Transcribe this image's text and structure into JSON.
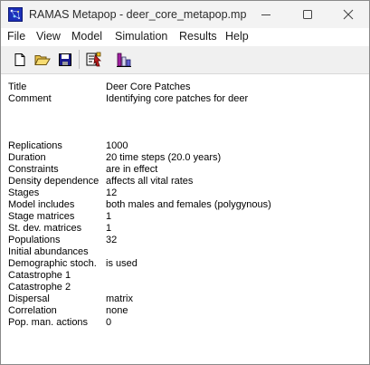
{
  "window": {
    "title": "RAMAS Metapop - deer_core_metapop.mp",
    "app_icon": "ramas-metapop-app-icon",
    "controls": {
      "minimize": "minimize-icon",
      "maximize": "maximize-icon",
      "close": "close-icon"
    }
  },
  "menu": {
    "items": [
      "File",
      "View",
      "Model",
      "Simulation",
      "Results",
      "Help"
    ]
  },
  "toolbar": {
    "buttons": [
      {
        "name": "new-file-button",
        "icon": "new-document-icon"
      },
      {
        "name": "open-file-button",
        "icon": "open-folder-icon"
      },
      {
        "name": "save-file-button",
        "icon": "floppy-disk-icon"
      },
      {
        "name": "run-simulation-button",
        "icon": "run-simulation-icon"
      },
      {
        "name": "results-button",
        "icon": "results-bars-icon"
      }
    ]
  },
  "summary": {
    "header": [
      {
        "label": "Title",
        "value": "Deer Core Patches"
      },
      {
        "label": "Comment",
        "value": "Identifying core patches for deer"
      }
    ],
    "rows": [
      {
        "label": "Replications",
        "value": "1000"
      },
      {
        "label": "Duration",
        "value": "20 time steps (20.0 years)"
      },
      {
        "label": "Constraints",
        "value": "are in effect"
      },
      {
        "label": "Density dependence",
        "value": "affects all vital rates"
      },
      {
        "label": "Stages",
        "value": "12"
      },
      {
        "label": "Model includes",
        "value": "both males and females (polygynous)"
      },
      {
        "label": "Stage matrices",
        "value": "1"
      },
      {
        "label": "St. dev. matrices",
        "value": "1"
      },
      {
        "label": "Populations",
        "value": "32"
      },
      {
        "label": "Initial abundances",
        "value": ""
      },
      {
        "label": "Demographic stoch.",
        "value": "is used"
      },
      {
        "label": "Catastrophe 1",
        "value": ""
      },
      {
        "label": "Catastrophe 2",
        "value": ""
      },
      {
        "label": "Dispersal",
        "value": "matrix"
      },
      {
        "label": "Correlation",
        "value": "none"
      },
      {
        "label": "Pop. man. actions",
        "value": "0"
      }
    ]
  }
}
